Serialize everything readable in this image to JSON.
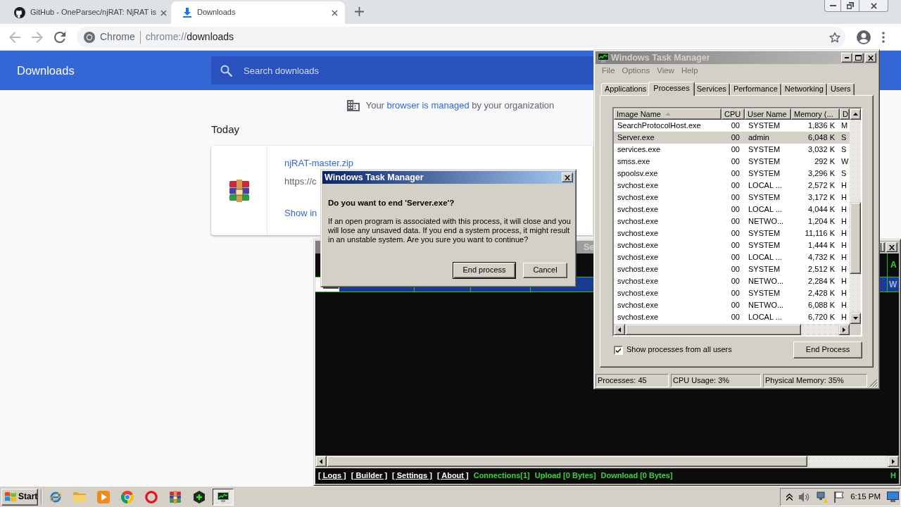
{
  "browser": {
    "tabs": [
      {
        "title": "GitHub - OneParsec/njRAT: NjRAT is",
        "kind": "site",
        "selected": false
      },
      {
        "title": "Downloads",
        "kind": "downloads",
        "selected": true
      }
    ],
    "omnibox": {
      "chip": "Chrome",
      "url": [
        "chrome://",
        "downloads"
      ]
    },
    "page": {
      "title": "Downloads",
      "search": {
        "placeholder": "Search downloads"
      },
      "notice": {
        "before": "Your",
        "link": "browser is managed",
        "after": "by your organization"
      },
      "section": "Today",
      "downloads": [
        {
          "file_name": "njRAT-master.zip",
          "source": "https://c",
          "action": "Show in"
        }
      ]
    }
  },
  "rat_window": {
    "title_fragment": "Se",
    "active": false,
    "column_fragment": "A",
    "rows": [
      {
        "fragment": "W",
        "selected": true
      }
    ],
    "links": [
      "[ Logs ]",
      "[ Builder ]",
      "[ Settings ]",
      "[ About ]"
    ],
    "stats": [
      "Connections[1]",
      "Upload [0 Bytes]",
      "Download [0 Bytes]"
    ],
    "status_fragment": "H"
  },
  "task_manager": {
    "title": "Windows Task Manager",
    "active": false,
    "menu": [
      "File",
      "Options",
      "View",
      "Help"
    ],
    "tabs": [
      {
        "label": "Applications",
        "selected": false
      },
      {
        "label": "Processes",
        "selected": true
      },
      {
        "label": "Services",
        "selected": false
      },
      {
        "label": "Performance",
        "selected": false
      },
      {
        "label": "Networking",
        "selected": false
      },
      {
        "label": "Users",
        "selected": false
      }
    ],
    "columns": [
      {
        "label": "Image Name",
        "sorted": true
      },
      {
        "label": "CPU",
        "sorted": false
      },
      {
        "label": "User Name",
        "sorted": false
      },
      {
        "label": "Memory (...",
        "sorted": false
      },
      {
        "label": "D",
        "sorted": false
      }
    ],
    "rows": [
      {
        "cells": [
          "SearchProtocolHost.exe",
          "00",
          "SYSTEM",
          "1,836 K",
          "M"
        ],
        "selected": false
      },
      {
        "cells": [
          "Server.exe",
          "00",
          "admin",
          "6,048 K",
          "S"
        ],
        "selected": true
      },
      {
        "cells": [
          "services.exe",
          "00",
          "SYSTEM",
          "3,032 K",
          "S"
        ],
        "selected": false
      },
      {
        "cells": [
          "smss.exe",
          "00",
          "SYSTEM",
          "292 K",
          "W"
        ],
        "selected": false
      },
      {
        "cells": [
          "spoolsv.exe",
          "00",
          "SYSTEM",
          "3,296 K",
          "S"
        ],
        "selected": false
      },
      {
        "cells": [
          "svchost.exe",
          "00",
          "LOCAL ...",
          "2,572 K",
          "H"
        ],
        "selected": false
      },
      {
        "cells": [
          "svchost.exe",
          "00",
          "SYSTEM",
          "3,172 K",
          "H"
        ],
        "selected": false
      },
      {
        "cells": [
          "svchost.exe",
          "00",
          "LOCAL ...",
          "4,044 K",
          "H"
        ],
        "selected": false
      },
      {
        "cells": [
          "svchost.exe",
          "00",
          "NETWO...",
          "1,204 K",
          "H"
        ],
        "selected": false
      },
      {
        "cells": [
          "svchost.exe",
          "00",
          "SYSTEM",
          "11,116 K",
          "H"
        ],
        "selected": false
      },
      {
        "cells": [
          "svchost.exe",
          "00",
          "SYSTEM",
          "1,444 K",
          "H"
        ],
        "selected": false
      },
      {
        "cells": [
          "svchost.exe",
          "00",
          "LOCAL ...",
          "4,732 K",
          "H"
        ],
        "selected": false
      },
      {
        "cells": [
          "svchost.exe",
          "00",
          "SYSTEM",
          "2,512 K",
          "H"
        ],
        "selected": false
      },
      {
        "cells": [
          "svchost.exe",
          "00",
          "NETWO...",
          "2,284 K",
          "H"
        ],
        "selected": false
      },
      {
        "cells": [
          "svchost.exe",
          "00",
          "SYSTEM",
          "2,428 K",
          "H"
        ],
        "selected": false
      },
      {
        "cells": [
          "svchost.exe",
          "00",
          "NETWO...",
          "6,088 K",
          "H"
        ],
        "selected": false
      },
      {
        "cells": [
          "svchost.exe",
          "00",
          "LOCAL ...",
          "6,720 K",
          "H"
        ],
        "selected": false
      }
    ],
    "show_all_users": {
      "label": "Show processes from all users",
      "checked": true
    },
    "end_button": "End Process",
    "status": [
      "Processes: 45",
      "CPU Usage: 3%",
      "Physical Memory: 35%"
    ]
  },
  "dialog": {
    "title": "Windows Task Manager",
    "active": true,
    "question": "Do you want to end 'Server.exe'?",
    "message": "If an open program is associated with this process, it will close and you will lose any unsaved data. If you end a system process, it might result in an unstable system. Are you sure you want to continue?",
    "buttons": [
      {
        "label": "End process",
        "default": true
      },
      {
        "label": "Cancel",
        "default": false
      }
    ]
  },
  "taskbar": {
    "start": "Start",
    "apps": [
      {
        "kind": "browser",
        "pressed": false
      },
      {
        "kind": "folder",
        "pressed": false
      },
      {
        "kind": "media",
        "pressed": false
      },
      {
        "kind": "logo",
        "pressed": false
      },
      {
        "kind": "ring",
        "pressed": false
      },
      {
        "kind": "archive",
        "pressed": false
      },
      {
        "kind": "hexagon",
        "pressed": false
      },
      {
        "kind": "monitor",
        "pressed": true
      }
    ],
    "clock": "6:15 PM"
  }
}
